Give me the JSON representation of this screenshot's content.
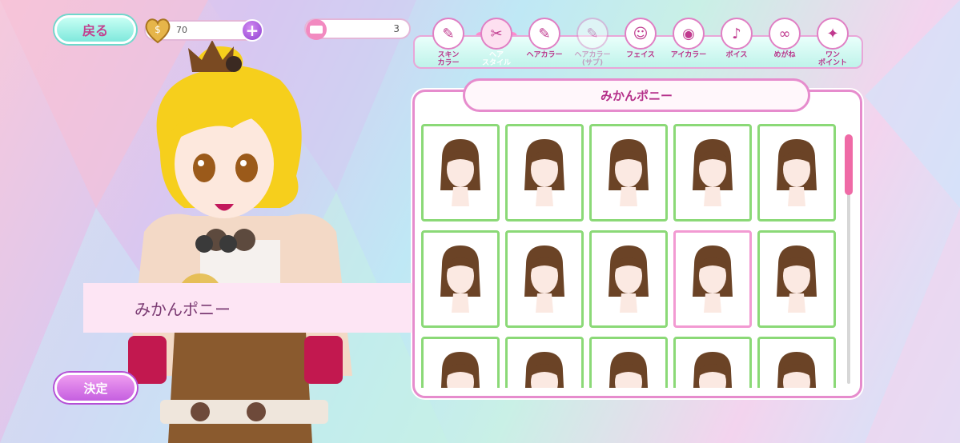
{
  "header": {
    "back_label": "戻る",
    "coins": "70",
    "coin_plus": "+",
    "tickets": "3"
  },
  "tabs": [
    {
      "label": "スキン\nカラー",
      "icon": "skin-color-icon"
    },
    {
      "label": "ヘア\nスタイル",
      "icon": "hair-style-icon",
      "active": true
    },
    {
      "label": "ヘアカラー",
      "icon": "hair-color-icon"
    },
    {
      "label": "ヘアカラー\n(サブ)",
      "icon": "hair-color-sub-icon",
      "disabled": true
    },
    {
      "label": "フェイス",
      "icon": "face-icon"
    },
    {
      "label": "アイカラー",
      "icon": "eye-color-icon"
    },
    {
      "label": "ボイス",
      "icon": "microphone-icon"
    },
    {
      "label": "めがね",
      "icon": "glasses-icon"
    },
    {
      "label": "ワン\nポイント",
      "icon": "one-point-icon"
    }
  ],
  "panel": {
    "title": "みかんポニー",
    "hairstyles": [
      {
        "id": "bob"
      },
      {
        "id": "medium"
      },
      {
        "id": "double-bun"
      },
      {
        "id": "side-pony"
      },
      {
        "id": "short"
      },
      {
        "id": "flip"
      },
      {
        "id": "braid-band"
      },
      {
        "id": "straight"
      },
      {
        "id": "mikan-pony",
        "selected": true
      },
      {
        "id": "top-bun"
      },
      {
        "id": "twin-tail"
      },
      {
        "id": "spiky"
      },
      {
        "id": "half-up"
      },
      {
        "id": "wave"
      },
      {
        "id": "short-bob"
      }
    ]
  },
  "character": {
    "name": "みかんポニー"
  },
  "confirm_label": "決定",
  "colors": {
    "accent": "#e68ccd",
    "hair": "#6b4326",
    "green_border": "#8bd977",
    "selected_border": "#f29ad2"
  }
}
